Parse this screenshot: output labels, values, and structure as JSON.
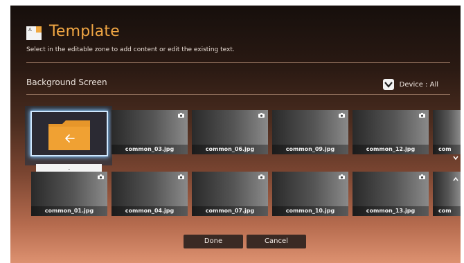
{
  "header": {
    "title": "Template",
    "subtitle": "Select in the editable zone to add content or edit the existing text."
  },
  "section": {
    "title": "Background Screen",
    "device_label": "Device : All"
  },
  "folder": {
    "label": ".."
  },
  "grid": {
    "row1": [
      {
        "name": "common_03.jpg"
      },
      {
        "name": "common_06.jpg"
      },
      {
        "name": "common_09.jpg"
      },
      {
        "name": "common_12.jpg"
      },
      {
        "name": "com"
      }
    ],
    "row2": [
      {
        "name": "common_01.jpg"
      },
      {
        "name": "common_04.jpg"
      },
      {
        "name": "common_07.jpg"
      },
      {
        "name": "common_10.jpg"
      },
      {
        "name": "common_13.jpg"
      },
      {
        "name": "com"
      }
    ]
  },
  "buttons": {
    "done": "Done",
    "cancel": "Cancel"
  },
  "colors": {
    "accent": "#f1a744",
    "focus": "#7fc4ff"
  },
  "icons": {
    "template": "template-icon",
    "dropdown": "chevron-down-icon",
    "camera": "camera-icon",
    "folder": "folder-back-icon"
  }
}
